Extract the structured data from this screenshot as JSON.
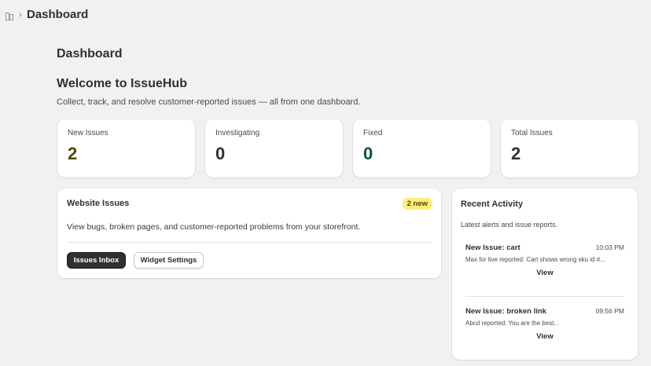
{
  "breadcrumb": {
    "title": "Dashboard",
    "separator": "›"
  },
  "page": {
    "title": "Dashboard",
    "welcome": "Welcome to IssueHub",
    "subtitle": "Collect, track, and resolve customer-reported issues — all from one dashboard."
  },
  "stats": [
    {
      "label": "New Issues",
      "value": "2",
      "color": "#4f4700"
    },
    {
      "label": "Investigating",
      "value": "0",
      "color": "#303030"
    },
    {
      "label": "Fixed",
      "value": "0",
      "color": "#0c5132"
    },
    {
      "label": "Total Issues",
      "value": "2",
      "color": "#303030"
    }
  ],
  "issues_card": {
    "title": "Website Issues",
    "badge": "2 new",
    "description": "View bugs, broken pages, and customer-reported problems from your storefront.",
    "primary_button": "Issues Inbox",
    "secondary_button": "Widget Settings"
  },
  "activity": {
    "title": "Recent Activity",
    "subtitle": "Latest alerts and issue reports.",
    "items": [
      {
        "title": "New Issue: cart",
        "time": "10:03 PM",
        "description": "Max for live reported: Cart shows wrong sku id #...",
        "action": "View"
      },
      {
        "title": "New Issue: broken link",
        "time": "09:56 PM",
        "description": "Abcd reported: You are the best...",
        "action": "View"
      }
    ]
  },
  "colors": {
    "background": "#f1f1f1",
    "card": "#ffffff",
    "badge": "#ffeb78",
    "primary_button": "#303030"
  },
  "icons": {
    "breadcrumb": "page-icon"
  }
}
